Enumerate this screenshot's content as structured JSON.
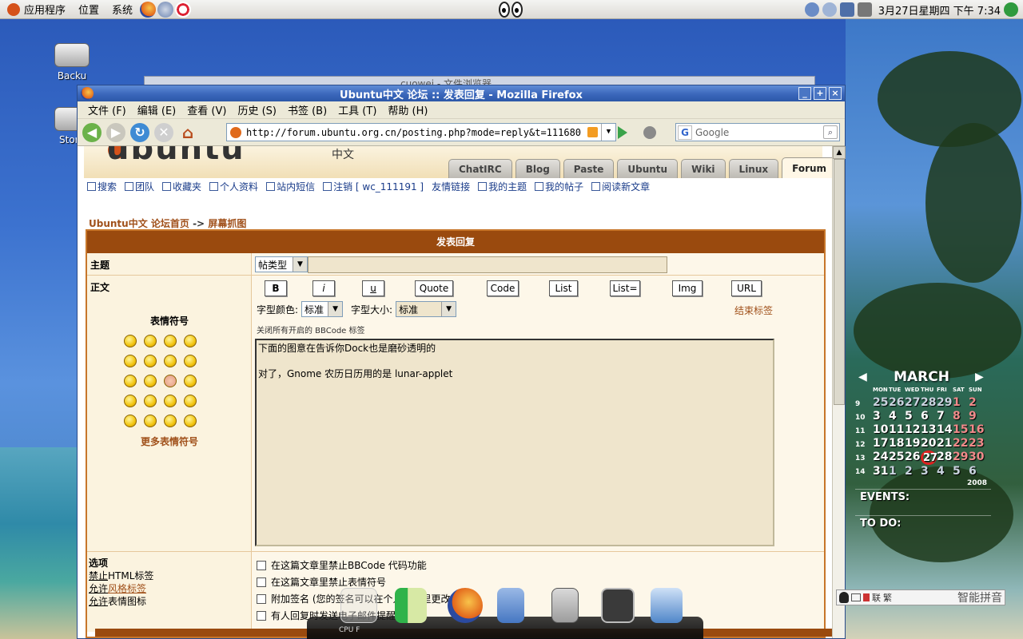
{
  "panel": {
    "menus": [
      "应用程序",
      "位置",
      "系统"
    ],
    "clock": "3月27日星期四 下午 7:34"
  },
  "desktop": {
    "icons": [
      {
        "label": "Backu"
      },
      {
        "label": "Stora"
      }
    ],
    "background_window_title": "cuowei - 文件浏览器"
  },
  "firefox": {
    "title": "Ubuntu中文 论坛 :: 发表回复 - Mozilla Firefox",
    "menu": [
      "文件 (F)",
      "编辑 (E)",
      "查看 (V)",
      "历史 (S)",
      "书签 (B)",
      "工具 (T)",
      "帮助 (H)"
    ],
    "url": "http://forum.ubuntu.org.cn/posting.php?mode=reply&t=111680",
    "search_placeholder": "Google"
  },
  "site": {
    "logo_text": "ubuntu",
    "logo_cn": "中文",
    "tabs": [
      "ChatIRC",
      "Blog",
      "Paste",
      "Ubuntu",
      "Wiki",
      "Linux",
      "Forum"
    ],
    "active_tab": "Forum",
    "links": [
      "搜索",
      "团队",
      "收藏夹",
      "个人资料",
      "站内短信",
      "注销 [ wc_111191 ]",
      "友情链接",
      "我的主题",
      "我的帖子",
      "阅读新文章"
    ],
    "breadcrumb": {
      "home": "Ubuntu中文 论坛首页",
      "sep": "->",
      "current": "屏幕抓图"
    }
  },
  "form": {
    "heading": "发表回复",
    "subject_label": "主题",
    "post_type": "帖类型",
    "body_label": "正文",
    "smilies_title": "表情符号",
    "more_smilies": "更多表情符号",
    "bbcode_buttons": [
      "B",
      "i",
      "u",
      "Quote",
      "Code",
      "List",
      "List=",
      "Img",
      "URL"
    ],
    "font_color_label": "字型颜色:",
    "font_color_value": "标准",
    "font_size_label": "字型大小:",
    "font_size_value": "标准",
    "close_tags": "结束标签",
    "close_all": "关闭所有开启的 BBCode 标签",
    "message": "下面的图意在告诉你Dock也是磨砂透明的\n\n对了，Gnome 农历日历用的是 lunar-applet",
    "options_label": "选项",
    "option_status": [
      {
        "pre": "禁止",
        "rest": "HTML标签"
      },
      {
        "pre": "允许",
        "rest": "风格标签"
      },
      {
        "pre": "允许",
        "rest": "表情图标"
      }
    ],
    "options": [
      "在这篇文章里禁止BBCode 代码功能",
      "在这篇文章里禁止表情符号",
      "附加签名 (您的签名可以在个人资料里更改)",
      "有人回复时发送电子邮件提醒我"
    ]
  },
  "dock": {
    "label": "CPU F"
  },
  "calendar": {
    "month": "MARCH",
    "year": "2008",
    "dow": [
      "MON",
      "TUE",
      "WED",
      "THU",
      "FRI",
      "SAT",
      "SUN"
    ],
    "weeks": [
      "9",
      "10",
      "11",
      "12",
      "13",
      "14"
    ],
    "days": [
      [
        "25",
        "26",
        "27",
        "28",
        "29",
        "1",
        "2"
      ],
      [
        "3",
        "4",
        "5",
        "6",
        "7",
        "8",
        "9"
      ],
      [
        "10",
        "11",
        "12",
        "13",
        "14",
        "15",
        "16"
      ],
      [
        "17",
        "18",
        "19",
        "20",
        "21",
        "22",
        "23"
      ],
      [
        "24",
        "25",
        "26",
        "27",
        "28",
        "29",
        "30"
      ],
      [
        "31",
        "1",
        "2",
        "3",
        "4",
        "5",
        "6"
      ]
    ],
    "today": "27",
    "events_label": "EVENTS:",
    "todo_label": "TO DO:"
  },
  "ime": {
    "items": [
      "联",
      "繁"
    ],
    "name": "智能拼音"
  }
}
